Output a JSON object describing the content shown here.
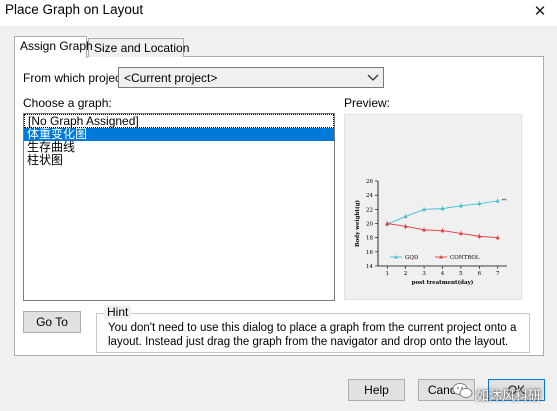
{
  "window": {
    "title": "Place Graph on Layout",
    "close_glyph": "✕"
  },
  "tabs": [
    {
      "label": "Assign Graph",
      "active": true
    },
    {
      "label": "Size and Location",
      "active": false
    }
  ],
  "project": {
    "label": "From which project:",
    "value": "<Current project>"
  },
  "graph_list": {
    "label": "Choose a graph:",
    "items": [
      "[No Graph Assigned]",
      "体重变化图",
      "生存曲线",
      "柱状图"
    ],
    "selected_index": 1
  },
  "preview": {
    "label": "Preview:"
  },
  "goto_button": "Go To",
  "hint": {
    "title": "Hint",
    "text": "You don't need to use this dialog to place a graph from the current project onto a layout. Instead just drag the graph from the navigator and drop onto the layout."
  },
  "buttons": {
    "help": "Help",
    "cancel": "Cancel",
    "ok": "OK"
  },
  "watermark": {
    "text": "如沐风科研",
    "icon": "wechat-icon"
  },
  "colors": {
    "accent": "#0078d7",
    "series_gqd": "#3fbfd6",
    "series_control": "#e83c3c"
  },
  "chart_data": {
    "type": "line",
    "x": [
      1,
      2,
      3,
      4,
      5,
      6,
      7
    ],
    "xlabel": "post treatment(day)",
    "ylabel": "Body weight(g)",
    "ylim": [
      14,
      26
    ],
    "yticks": [
      14,
      16,
      18,
      20,
      22,
      24,
      26
    ],
    "xticks": [
      1,
      2,
      3,
      4,
      5,
      6,
      7
    ],
    "annotation": "**",
    "series": [
      {
        "name": "GQD",
        "values": [
          19.9,
          21.0,
          22.0,
          22.1,
          22.5,
          22.8,
          23.2
        ],
        "color": "#3fbfd6",
        "marker": "triangle"
      },
      {
        "name": "CONTROL",
        "values": [
          20.0,
          19.6,
          19.1,
          19.0,
          18.6,
          18.2,
          18.0
        ],
        "color": "#e83c3c",
        "marker": "triangle"
      }
    ],
    "legend": "bottom"
  }
}
